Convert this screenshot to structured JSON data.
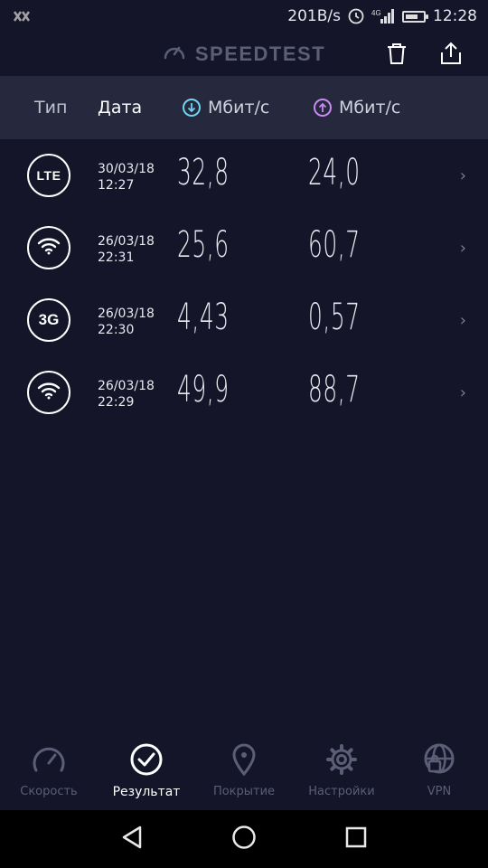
{
  "status_bar": {
    "left_icon": "notification-x-icon",
    "speed": "201B/s",
    "network": "4G",
    "time": "12:28"
  },
  "app": {
    "title": "SPEEDTEST",
    "actions": [
      "delete-icon",
      "share-icon"
    ]
  },
  "header": {
    "type": "Тип",
    "date": "Дата",
    "download": "Мбит/с",
    "upload": "Мбит/с",
    "download_color": "#6fd4f0",
    "upload_color": "#c88af0"
  },
  "results": [
    {
      "type": "LTE",
      "date": "30/03/18",
      "time": "12:27",
      "download": "32,8",
      "upload": "24,0"
    },
    {
      "type": "wifi",
      "date": "26/03/18",
      "time": "22:31",
      "download": "25,6",
      "upload": "60,7"
    },
    {
      "type": "3G",
      "date": "26/03/18",
      "time": "22:30",
      "download": "4,43",
      "upload": "0,57"
    },
    {
      "type": "wifi",
      "date": "26/03/18",
      "time": "22:29",
      "download": "49,9",
      "upload": "88,7"
    }
  ],
  "bottom_nav": [
    {
      "label": "Скорость",
      "icon": "speedometer-icon",
      "active": false
    },
    {
      "label": "Результат",
      "icon": "check-circle-icon",
      "active": true
    },
    {
      "label": "Покрытие",
      "icon": "map-pin-icon",
      "active": false
    },
    {
      "label": "Настройки",
      "icon": "gear-icon",
      "active": false
    },
    {
      "label": "VPN",
      "icon": "globe-lock-icon",
      "active": false
    }
  ]
}
